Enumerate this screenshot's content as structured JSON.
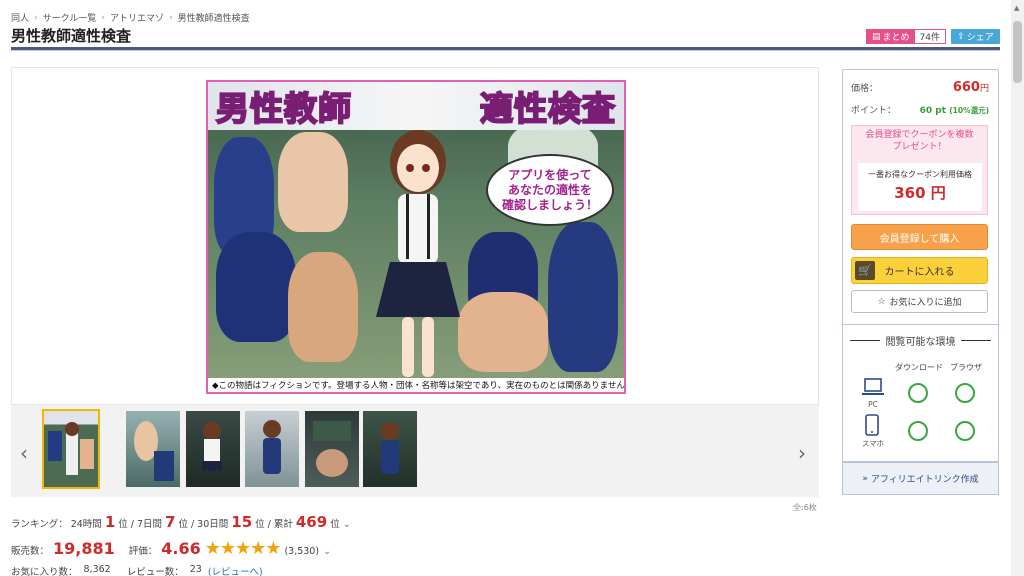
{
  "breadcrumb": [
    "同人",
    "サークル一覧",
    "アトリエマゾ",
    "男性教師適性検査"
  ],
  "page_title": "男性教師適性検査",
  "matome": {
    "label": "まとめ",
    "count": "74件"
  },
  "share_label": "シェア",
  "hero": {
    "banner_left": "男性教師",
    "banner_right": "適性検査",
    "bubble": "アプリを使って\nあなたの適性を\n確認しましょう！",
    "caption": "◆この物語はフィクションです。登場する人物・団体・名称等は架空であり、実在のものとは関係ありません。"
  },
  "thumbnails_total": "全:6枚",
  "ranking": {
    "label": "ランキング：",
    "h24_label": "24時間",
    "h24": "1",
    "d7_label": "7日間",
    "d7": "7",
    "d30_label": "30日間",
    "d30": "15",
    "total_label": "累計",
    "total": "469",
    "unit": "位"
  },
  "sales": {
    "label": "販売数：",
    "value": "19,881"
  },
  "rating": {
    "label": "評価：",
    "value": "4.66",
    "count": "(3,530)",
    "stars": "★★★★★"
  },
  "favorites": {
    "label": "お気に入り数：",
    "value": "8,362"
  },
  "reviews": {
    "label": "レビュー数：",
    "value": "23",
    "link": "(レビューへ)"
  },
  "price": {
    "label": "価格：",
    "value": "660",
    "unit": "円"
  },
  "point": {
    "label": "ポイント：",
    "value": "60",
    "unit": "pt",
    "note": "(10%還元)"
  },
  "coupon": {
    "head": "会員登録でクーポンを複数\nプレゼント！",
    "box_label": "一番お得なクーポン利用価格",
    "box_value": "360 円"
  },
  "buttons": {
    "member": "会員登録して購入",
    "cart": "カートに入れる",
    "favorite": "お気に入りに追加"
  },
  "environment": {
    "title": "閲覧可能な環境",
    "col_download": "ダウンロード",
    "col_browser": "ブラウザ",
    "pc": "PC",
    "phone": "スマホ"
  },
  "affiliate": "アフィリエイトリンク作成"
}
